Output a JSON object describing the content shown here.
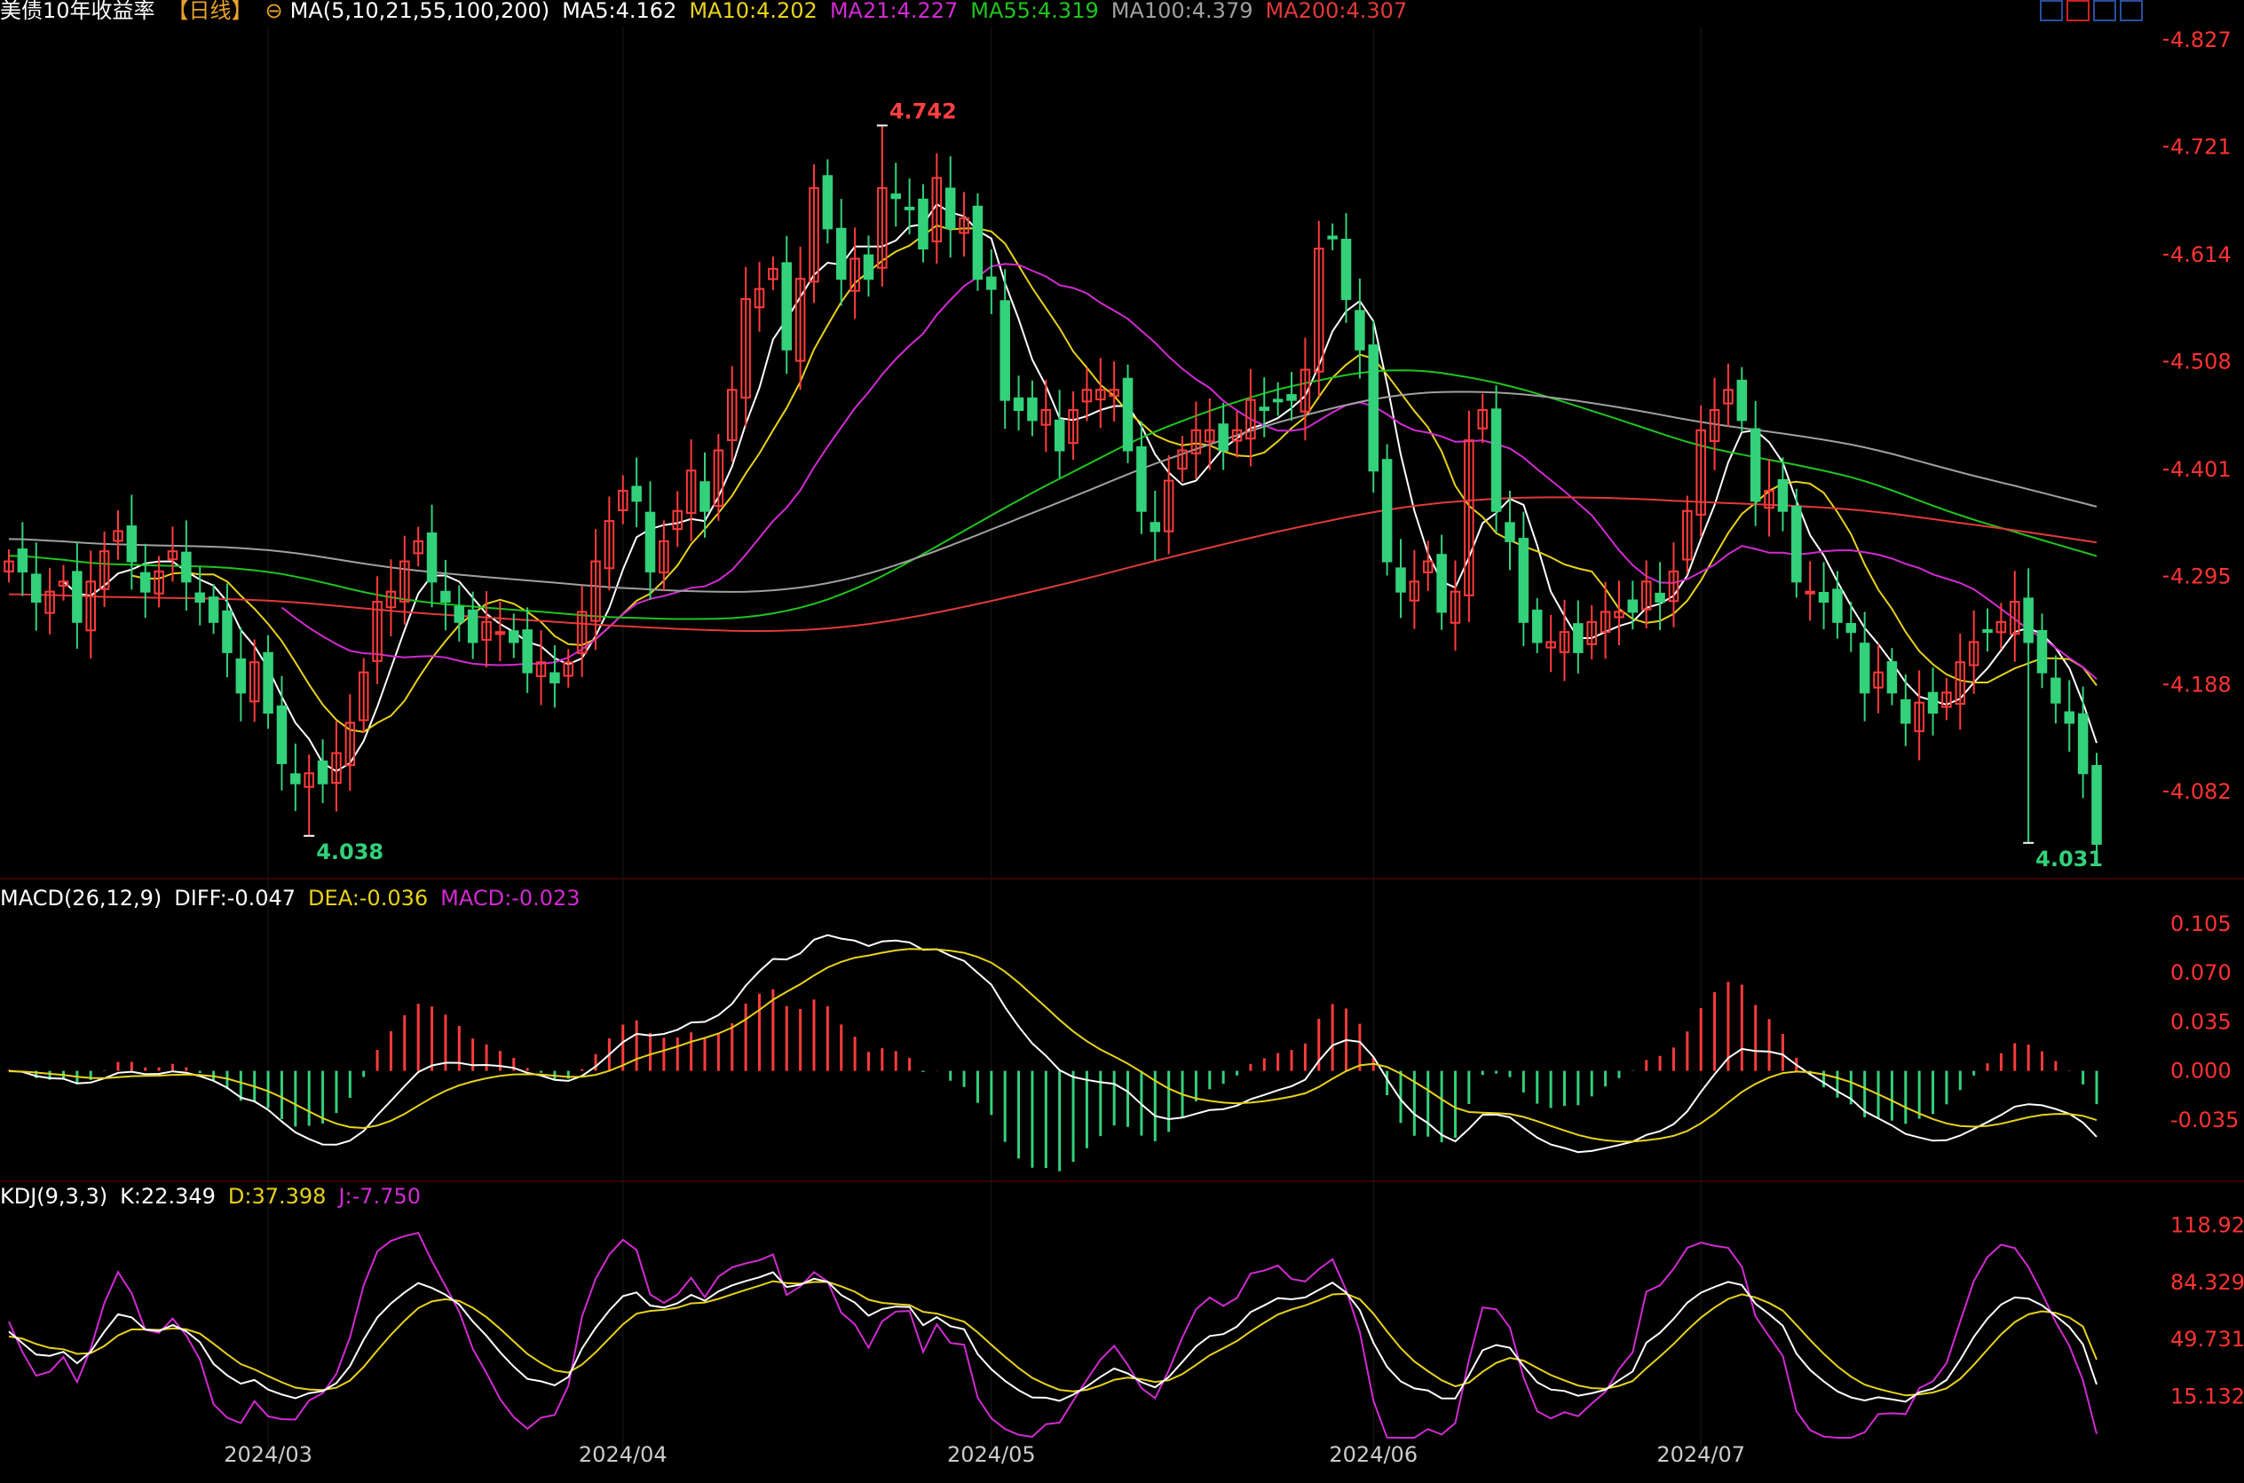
{
  "header": {
    "symbol": "美债10年收益率",
    "period": "【日线】",
    "ma_label": "MA(5,10,21,55,100,200)",
    "ma": [
      {
        "label": "MA5:4.162",
        "color": "#ffffff"
      },
      {
        "label": "MA10:4.202",
        "color": "#e8d21a"
      },
      {
        "label": "MA21:4.227",
        "color": "#d22ad2"
      },
      {
        "label": "MA55:4.319",
        "color": "#1fc51f"
      },
      {
        "label": "MA100:4.379",
        "color": "#a0a0a0"
      },
      {
        "label": "MA200:4.307",
        "color": "#e23a3a"
      }
    ]
  },
  "macd_legend": {
    "name": "MACD(26,12,9)",
    "diff": "DIFF:-0.047",
    "dea": "DEA:-0.036",
    "macd": "MACD:-0.023"
  },
  "kdj_legend": {
    "name": "KDJ(9,3,3)",
    "k": "K:22.349",
    "d": "D:37.398",
    "j": "J:-7.750"
  },
  "colors": {
    "up": "#ff3b3b",
    "down": "#33d17a",
    "axis_text": "#ff3333",
    "date_text": "#cccccc",
    "grid": "#3a0000"
  },
  "chart_data": [
    {
      "type": "candlestick",
      "title": "美债10年收益率",
      "y_ticks": [
        "4.827",
        "4.721",
        "4.614",
        "4.508",
        "4.401",
        "4.295",
        "4.188",
        "4.082"
      ],
      "ylim": [
        4.0,
        4.84
      ],
      "x_ticks": [
        {
          "label": "2024/03",
          "index": 19
        },
        {
          "label": "2024/04",
          "index": 45
        },
        {
          "label": "2024/05",
          "index": 72
        },
        {
          "label": "2024/06",
          "index": 100
        },
        {
          "label": "2024/07",
          "index": 124
        }
      ],
      "annotations": [
        {
          "label": "4.742",
          "index": 64,
          "value": 4.742,
          "kind": "high"
        },
        {
          "label": "4.038",
          "index": 22,
          "value": 4.038,
          "kind": "low"
        },
        {
          "label": "4.031",
          "index": 148,
          "value": 4.031,
          "kind": "low"
        }
      ],
      "close": [
        4.31,
        4.3,
        4.27,
        4.28,
        4.29,
        4.25,
        4.29,
        4.32,
        4.34,
        4.31,
        4.28,
        4.3,
        4.32,
        4.29,
        4.27,
        4.25,
        4.22,
        4.18,
        4.21,
        4.16,
        4.11,
        4.09,
        4.1,
        4.09,
        4.12,
        4.15,
        4.2,
        4.27,
        4.28,
        4.31,
        4.33,
        4.29,
        4.27,
        4.25,
        4.23,
        4.25,
        4.24,
        4.23,
        4.2,
        4.21,
        4.19,
        4.21,
        4.26,
        4.31,
        4.35,
        4.38,
        4.37,
        4.3,
        4.33,
        4.36,
        4.4,
        4.36,
        4.42,
        4.48,
        4.57,
        4.58,
        4.6,
        4.52,
        4.59,
        4.68,
        4.64,
        4.59,
        4.61,
        4.59,
        4.68,
        4.67,
        4.66,
        4.62,
        4.69,
        4.64,
        4.65,
        4.59,
        4.58,
        4.47,
        4.46,
        4.45,
        4.46,
        4.42,
        4.46,
        4.48,
        4.48,
        4.48,
        4.42,
        4.36,
        4.34,
        4.39,
        4.42,
        4.44,
        4.44,
        4.42,
        4.44,
        4.47,
        4.46,
        4.47,
        4.47,
        4.5,
        4.62,
        4.63,
        4.57,
        4.52,
        4.4,
        4.31,
        4.28,
        4.29,
        4.31,
        4.26,
        4.28,
        4.43,
        4.46,
        4.36,
        4.33,
        4.25,
        4.23,
        4.23,
        4.24,
        4.22,
        4.25,
        4.26,
        4.26,
        4.26,
        4.29,
        4.27,
        4.3,
        4.36,
        4.44,
        4.46,
        4.48,
        4.45,
        4.37,
        4.38,
        4.36,
        4.29,
        4.28,
        4.27,
        4.25,
        4.24,
        4.18,
        4.2,
        4.18,
        4.15,
        4.17,
        4.16,
        4.18,
        4.21,
        4.23,
        4.24,
        4.25,
        4.27,
        4.23,
        4.2,
        4.17,
        4.15,
        4.1,
        4.03
      ]
    },
    {
      "type": "macd_histogram",
      "name": "MACD(26,12,9)",
      "y_ticks": [
        "0.105",
        "0.070",
        "0.035",
        "0.000",
        "-0.035"
      ],
      "ylim": [
        -0.075,
        0.115
      ],
      "diff_last": -0.047,
      "dea_last": -0.036,
      "macd_last": -0.023
    },
    {
      "type": "kdj",
      "name": "KDJ(9,3,3)",
      "y_ticks": [
        "118.929",
        "84.329",
        "49.731",
        "15.132"
      ],
      "ylim": [
        -10,
        130
      ],
      "k_last": 22.349,
      "d_last": 37.398,
      "j_last": -7.75
    }
  ]
}
